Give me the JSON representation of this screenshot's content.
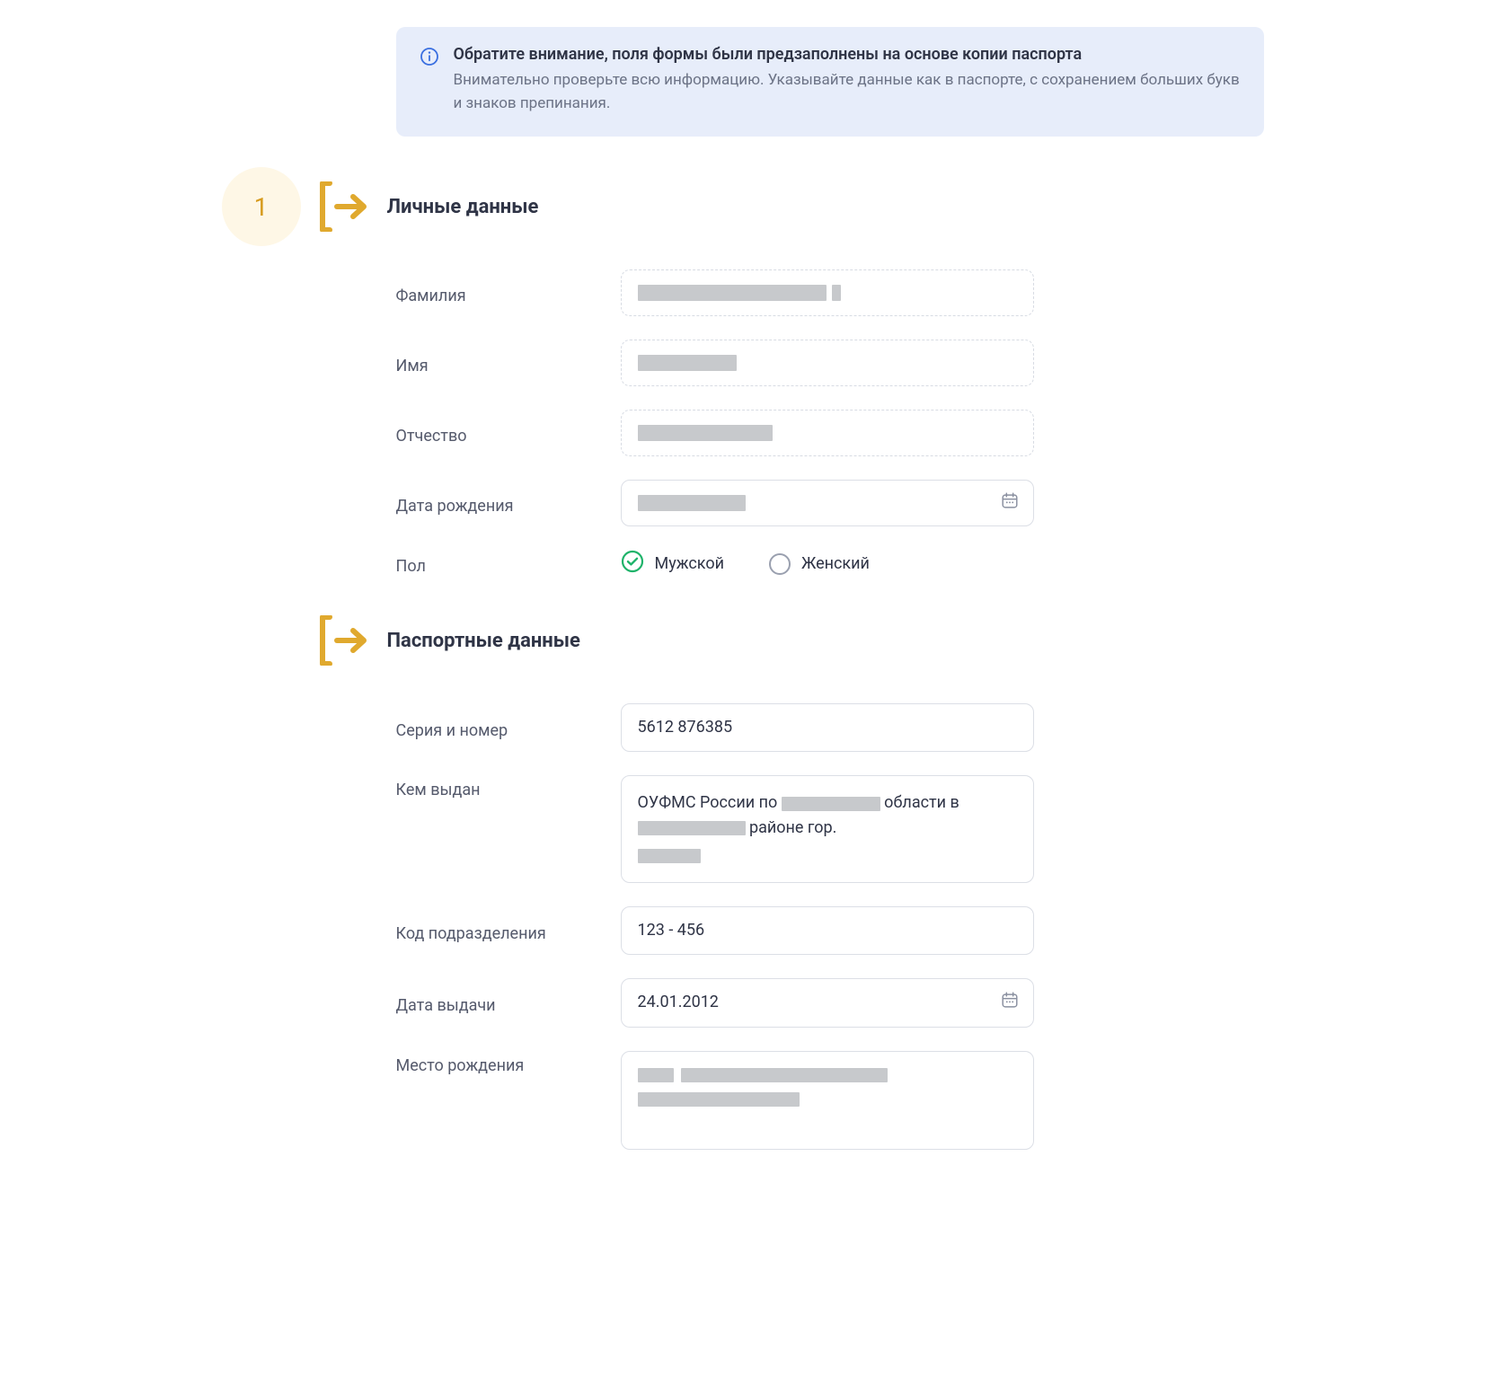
{
  "info": {
    "title": "Обратите внимание, поля формы были предзаполнены на основе копии паспорта",
    "body": "Внимательно проверьте всю информацию. Указывайте данные как в паспорте, с сохранением больших букв и знаков препинания."
  },
  "step_number": "1",
  "sections": {
    "personal": {
      "title": "Личные данные",
      "labels": {
        "surname": "Фамилия",
        "name": "Имя",
        "patronymic": "Отчество",
        "birthdate": "Дата рождения",
        "gender": "Пол"
      },
      "gender": {
        "male": "Мужской",
        "female": "Женский",
        "selected": "male"
      }
    },
    "passport": {
      "title": "Паспортные данные",
      "labels": {
        "series_number": "Серия и номер",
        "issued_by": "Кем выдан",
        "dept_code": "Код подразделения",
        "issue_date": "Дата выдачи",
        "birthplace": "Место рождения"
      },
      "values": {
        "series_number": "5612 876385",
        "issued_by_prefix": "ОУФМС России по ",
        "issued_by_mid1": " области в ",
        "issued_by_suffix": " районе гор. ",
        "dept_code": "123 - 456",
        "issue_date": "24.01.2012"
      }
    }
  },
  "icons": {
    "info": "info-circle-icon",
    "arrow": "bracket-arrow-icon",
    "calendar": "calendar-icon",
    "check": "check-circle-icon",
    "radio": "radio-empty-icon"
  }
}
